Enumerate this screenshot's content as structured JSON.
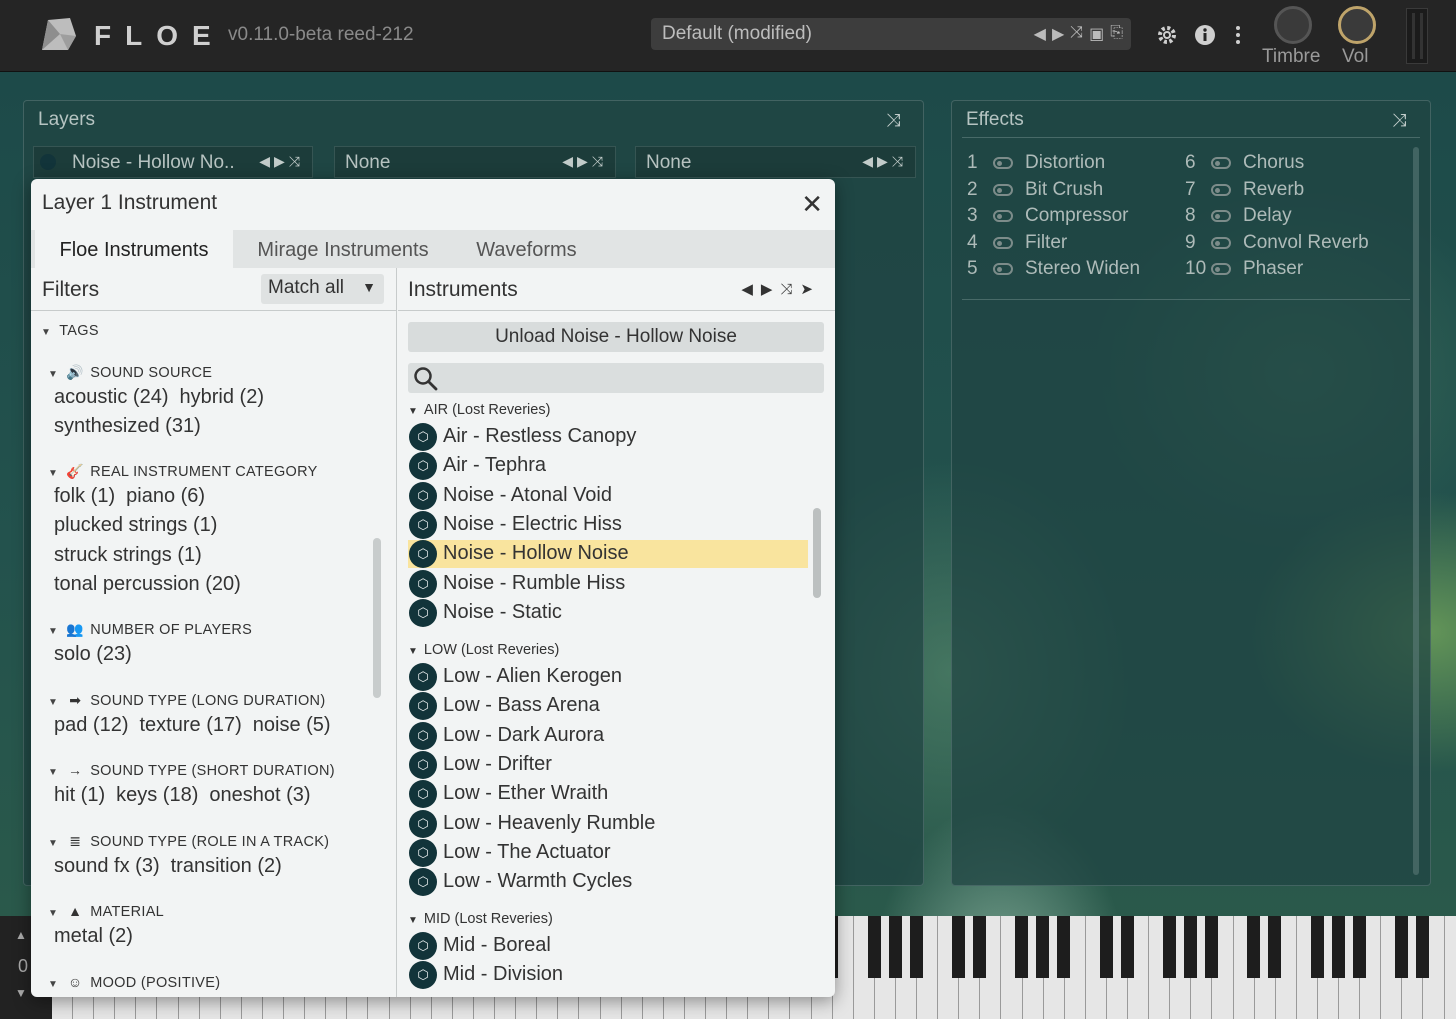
{
  "app": {
    "logo_text": "FLOE",
    "version": "v0.11.0-beta  reed-212",
    "preset": "Default (modified)",
    "knobs": [
      {
        "label": "Timbre"
      },
      {
        "label": "Vol"
      }
    ],
    "preset_icons": [
      "prev-icon",
      "next-icon",
      "shuffle-icon",
      "save-icon",
      "load-icon"
    ],
    "top_icons": [
      "gear-icon",
      "info-icon",
      "more-vertical-icon"
    ]
  },
  "layers": {
    "title": "Layers",
    "slots": [
      {
        "name": "Noise - Hollow No.."
      },
      {
        "name": "None"
      },
      {
        "name": "None"
      }
    ]
  },
  "effects": {
    "title": "Effects",
    "items": [
      {
        "num": "1",
        "name": "Distortion"
      },
      {
        "num": "2",
        "name": "Bit Crush"
      },
      {
        "num": "3",
        "name": "Compressor"
      },
      {
        "num": "4",
        "name": "Filter"
      },
      {
        "num": "5",
        "name": "Stereo Widen"
      },
      {
        "num": "6",
        "name": "Chorus"
      },
      {
        "num": "7",
        "name": "Reverb"
      },
      {
        "num": "8",
        "name": "Delay"
      },
      {
        "num": "9",
        "name": "Convol Reverb"
      },
      {
        "num": "10",
        "name": "Phaser"
      }
    ]
  },
  "keyboard": {
    "octave": "0"
  },
  "modal": {
    "title": "Layer 1 Instrument",
    "tabs": [
      "Floe Instruments",
      "Mirage Instruments",
      "Waveforms"
    ],
    "filters": {
      "title": "Filters",
      "match": "Match all",
      "tags_header": "TAGS",
      "sections": [
        {
          "title": "SOUND SOURCE",
          "icon": "speaker-icon",
          "rows": [
            [
              "acoustic (24)",
              "hybrid (2)"
            ],
            [
              "synthesized (31)"
            ]
          ]
        },
        {
          "title": "REAL INSTRUMENT CATEGORY",
          "icon": "guitar-icon",
          "rows": [
            [
              "folk (1)",
              "piano (6)"
            ],
            [
              "plucked strings (1)"
            ],
            [
              "struck strings (1)"
            ],
            [
              "tonal percussion (20)"
            ]
          ]
        },
        {
          "title": "NUMBER OF PLAYERS",
          "icon": "people-icon",
          "rows": [
            [
              "solo (23)"
            ]
          ]
        },
        {
          "title": "SOUND TYPE (LONG DURATION)",
          "icon": "long-arrow-icon",
          "rows": [
            [
              "pad (12)",
              "texture (17)",
              "noise (5)"
            ]
          ]
        },
        {
          "title": "SOUND TYPE (SHORT DURATION)",
          "icon": "short-arrow-icon",
          "rows": [
            [
              "hit (1)",
              "keys (18)",
              "oneshot (3)"
            ]
          ]
        },
        {
          "title": "SOUND TYPE (ROLE IN A TRACK)",
          "icon": "layers-icon",
          "rows": [
            [
              "sound fx (3)",
              "transition (2)"
            ]
          ]
        },
        {
          "title": "MATERIAL",
          "icon": "tree-icon",
          "rows": [
            [
              "metal (2)"
            ]
          ]
        },
        {
          "title": "MOOD (POSITIVE)",
          "icon": "smile-icon",
          "rows": []
        }
      ]
    },
    "instruments": {
      "title": "Instruments",
      "unload": "Unload Noise - Hollow Noise",
      "search_placeholder": "",
      "selected": "Noise - Hollow Noise",
      "groups": [
        {
          "title": "AIR (Lost Reveries)",
          "items": [
            "Air - Restless Canopy",
            "Air - Tephra",
            "Noise - Atonal Void",
            "Noise - Electric Hiss",
            "Noise - Hollow Noise",
            "Noise - Rumble Hiss",
            "Noise - Static"
          ]
        },
        {
          "title": "LOW (Lost Reveries)",
          "items": [
            "Low - Alien Kerogen",
            "Low - Bass Arena",
            "Low - Dark Aurora",
            "Low - Drifter",
            "Low - Ether Wraith",
            "Low - Heavenly Rumble",
            "Low - The Actuator",
            "Low - Warmth Cycles"
          ]
        },
        {
          "title": "MID (Lost Reveries)",
          "items": [
            "Mid - Boreal",
            "Mid - Division"
          ]
        }
      ]
    }
  }
}
